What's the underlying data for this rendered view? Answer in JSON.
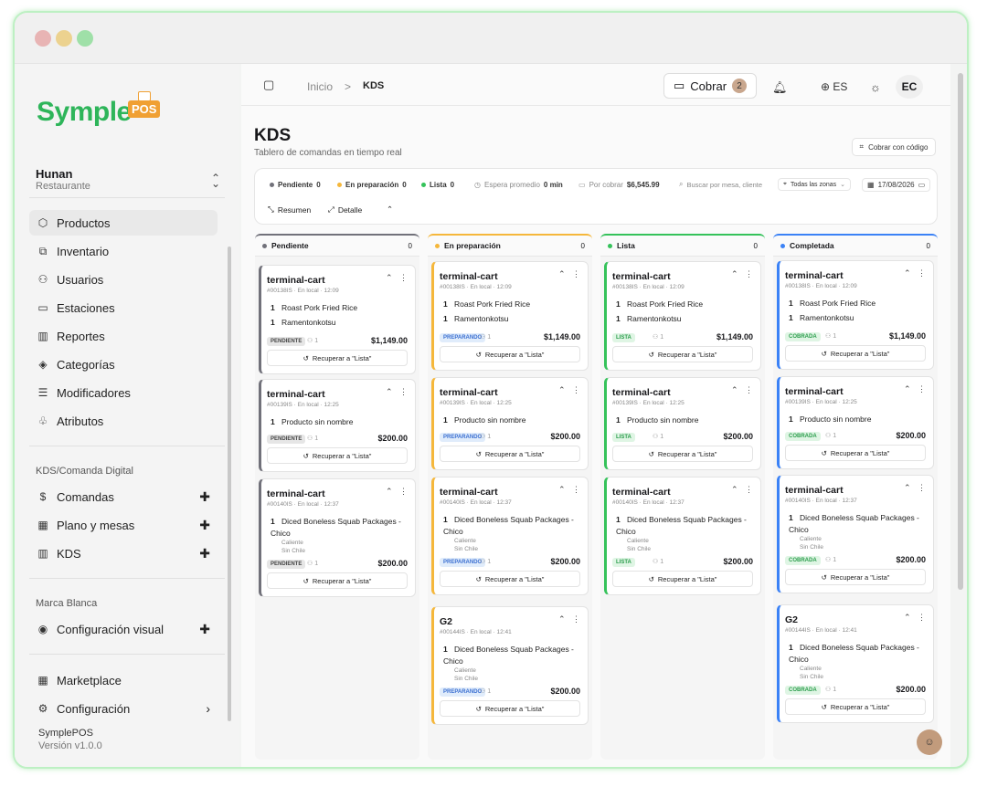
{
  "window": {
    "controls": [
      "close",
      "minimize",
      "maximize"
    ]
  },
  "sidebar": {
    "logo_main": "Symple",
    "logo_suffix": "POS",
    "tenant_name": "Hunan",
    "tenant_type": "Restaurante",
    "items": [
      {
        "label": "Productos",
        "icon": "box-icon"
      },
      {
        "label": "Inventario",
        "icon": "boxes-icon"
      },
      {
        "label": "Usuarios",
        "icon": "users-icon"
      },
      {
        "label": "Estaciones",
        "icon": "monitor-icon"
      },
      {
        "label": "Reportes",
        "icon": "bar-chart-icon"
      },
      {
        "label": "Categorías",
        "icon": "tag-icon"
      },
      {
        "label": "Modificadores",
        "icon": "sliders-icon"
      },
      {
        "label": "Atributos",
        "icon": "shapes-icon"
      }
    ],
    "kds_section": "KDS/Comanda Digital",
    "kds_items": [
      {
        "label": "Comandas",
        "icon": "receipt-icon"
      },
      {
        "label": "Plano y mesas",
        "icon": "map-icon"
      },
      {
        "label": "KDS",
        "icon": "columns-icon"
      }
    ],
    "brand_section": "Marca Blanca",
    "brand_items": [
      {
        "label": "Configuración visual",
        "icon": "palette-icon"
      }
    ],
    "bottom_items": [
      {
        "label": "Marketplace",
        "icon": "grid-icon"
      },
      {
        "label": "Configuración",
        "icon": "settings-icon"
      }
    ],
    "footer_app": "SymplePOS",
    "footer_version": "Versión v1.0.0"
  },
  "topbar": {
    "breadcrumb_home": "Inicio",
    "breadcrumb_sep": ">",
    "breadcrumb_current": "KDS",
    "cobrar_label": "Cobrar",
    "cobrar_count": "2",
    "language": "ES",
    "avatar": "EC"
  },
  "page": {
    "title": "KDS",
    "subtitle": "Tablero de comandas en tiempo real",
    "code_button": "Cobrar con código"
  },
  "filters": {
    "pendiente_label": "Pendiente",
    "pendiente_count": "0",
    "preparacion_label": "En preparación",
    "preparacion_count": "0",
    "lista_label": "Lista",
    "lista_count": "0",
    "espera_label": "Espera promedio",
    "espera_value": "0 min",
    "cobrar_label": "Por cobrar",
    "cobrar_value": "$6,545.99",
    "search_placeholder": "Buscar por mesa, cliente",
    "zone_label": "Todas las zonas",
    "date": "17/08/2026",
    "resumen": "Resumen",
    "detalle": "Detalle"
  },
  "columns": [
    {
      "name": "Pendiente",
      "count": "0",
      "color": "#71717a"
    },
    {
      "name": "En preparación",
      "count": "0",
      "color": "#f5b73b"
    },
    {
      "name": "Lista",
      "count": "0",
      "color": "#35c25a"
    },
    {
      "name": "Completada",
      "count": "0",
      "color": "#3b82f6"
    }
  ],
  "orders": [
    {
      "title": "terminal-cart",
      "meta": "#00138IS · En local · 12:09",
      "items": [
        {
          "qty": "1",
          "name": "Roast Pork Fried Rice"
        },
        {
          "qty": "1",
          "name": "Ramentonkotsu"
        }
      ],
      "guests": "1",
      "total": "$1,149.00"
    },
    {
      "title": "terminal-cart",
      "meta": "#00139IS · En local · 12:25",
      "items": [
        {
          "qty": "1",
          "name": "Producto sin nombre"
        }
      ],
      "guests": "1",
      "total": "$200.00"
    },
    {
      "title": "terminal-cart",
      "meta": "#00140IS · En local · 12:37",
      "items": [
        {
          "qty": "1",
          "name": "Diced Boneless Squab Packages - Chico",
          "mods": [
            "Caliente",
            "Sin Chile"
          ]
        }
      ],
      "guests": "1",
      "total": "$200.00"
    },
    {
      "title": "G2",
      "meta": "#00144IS · En local · 12:41",
      "items": [
        {
          "qty": "1",
          "name": "Diced Boneless Squab Packages - Chico",
          "mods": [
            "Caliente",
            "Sin Chile"
          ]
        }
      ],
      "guests": "1",
      "total": "$200.00"
    }
  ],
  "status_labels": [
    "PENDIENTE",
    "PREPARANDO",
    "LISTA",
    "COBRADA"
  ],
  "recover_label": "Recuperar a \"Lista\"",
  "colors": {
    "brand_green": "#2eb55a",
    "brand_orange": "#f0a033",
    "pending": "#71717a",
    "preparing": "#f5b73b",
    "ready": "#35c25a",
    "done": "#3b82f6"
  }
}
